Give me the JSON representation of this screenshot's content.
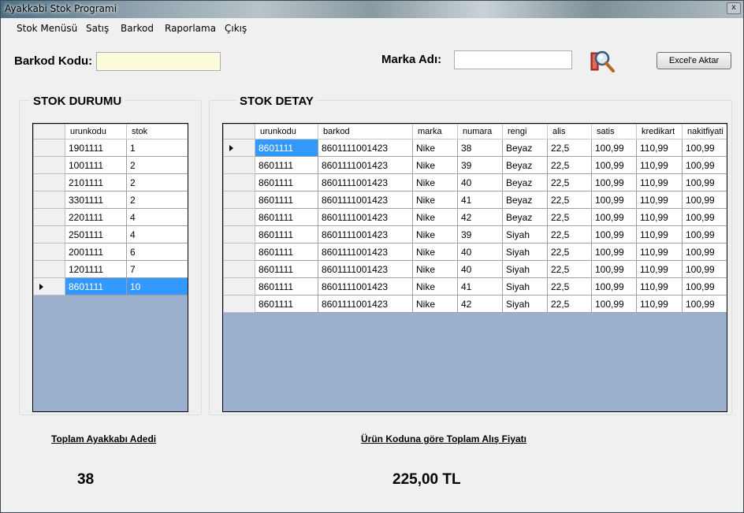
{
  "window": {
    "title": "Ayakkabi Stok Programi",
    "close": "x"
  },
  "menu": [
    "Stok Menüsü",
    "Satış",
    "Barkod",
    "Raporlama",
    "Çıkış"
  ],
  "search": {
    "barkod_label": "Barkod Kodu:",
    "barkod_value": "",
    "marka_label": "Marka Adı:",
    "marka_value": "",
    "excel_button": "Excel'e Aktar",
    "search_icon": "magnifier-icon"
  },
  "stok_durumu": {
    "title": "STOK DURUMU",
    "columns": [
      "urunkodu",
      "stok"
    ],
    "rows": [
      [
        "1901111",
        "1"
      ],
      [
        "1001111",
        "2"
      ],
      [
        "2101111",
        "2"
      ],
      [
        "3301111",
        "2"
      ],
      [
        "2201111",
        "4"
      ],
      [
        "2501111",
        "4"
      ],
      [
        "2001111",
        "6"
      ],
      [
        "1201111",
        "7"
      ],
      [
        "8601111",
        "10"
      ]
    ],
    "selected_row": 8
  },
  "stok_detay": {
    "title": "STOK DETAY",
    "columns": [
      "urunkodu",
      "barkod",
      "marka",
      "numara",
      "rengi",
      "alis",
      "satis",
      "kredikart",
      "nakitfiyati"
    ],
    "rows": [
      [
        "8601111",
        "8601111001423",
        "Nike",
        "38",
        "Beyaz",
        "22,5",
        "100,99",
        "110,99",
        "100,99"
      ],
      [
        "8601111",
        "8601111001423",
        "Nike",
        "39",
        "Beyaz",
        "22,5",
        "100,99",
        "110,99",
        "100,99"
      ],
      [
        "8601111",
        "8601111001423",
        "Nike",
        "40",
        "Beyaz",
        "22,5",
        "100,99",
        "110,99",
        "100,99"
      ],
      [
        "8601111",
        "8601111001423",
        "Nike",
        "41",
        "Beyaz",
        "22,5",
        "100,99",
        "110,99",
        "100,99"
      ],
      [
        "8601111",
        "8601111001423",
        "Nike",
        "42",
        "Beyaz",
        "22,5",
        "100,99",
        "110,99",
        "100,99"
      ],
      [
        "8601111",
        "8601111001423",
        "Nike",
        "39",
        "Siyah",
        "22,5",
        "100,99",
        "110,99",
        "100,99"
      ],
      [
        "8601111",
        "8601111001423",
        "Nike",
        "40",
        "Siyah",
        "22,5",
        "100,99",
        "110,99",
        "100,99"
      ],
      [
        "8601111",
        "8601111001423",
        "Nike",
        "40",
        "Siyah",
        "22,5",
        "100,99",
        "110,99",
        "100,99"
      ],
      [
        "8601111",
        "8601111001423",
        "Nike",
        "41",
        "Siyah",
        "22,5",
        "100,99",
        "110,99",
        "100,99"
      ],
      [
        "8601111",
        "8601111001423",
        "Nike",
        "42",
        "Siyah",
        "22,5",
        "100,99",
        "110,99",
        "100,99"
      ]
    ],
    "current_row": 0
  },
  "totals": {
    "adet_label": "Toplam Ayakkabı Adedi",
    "adet_value": "38",
    "fiyat_label": "Ürün Koduna göre Toplam Alış Fiyatı",
    "fiyat_value": "225,00 TL"
  },
  "colors": {
    "selection": "#3399ff",
    "grid_empty": "#9ab0cc",
    "highlight_input": "#fcfbdc"
  }
}
